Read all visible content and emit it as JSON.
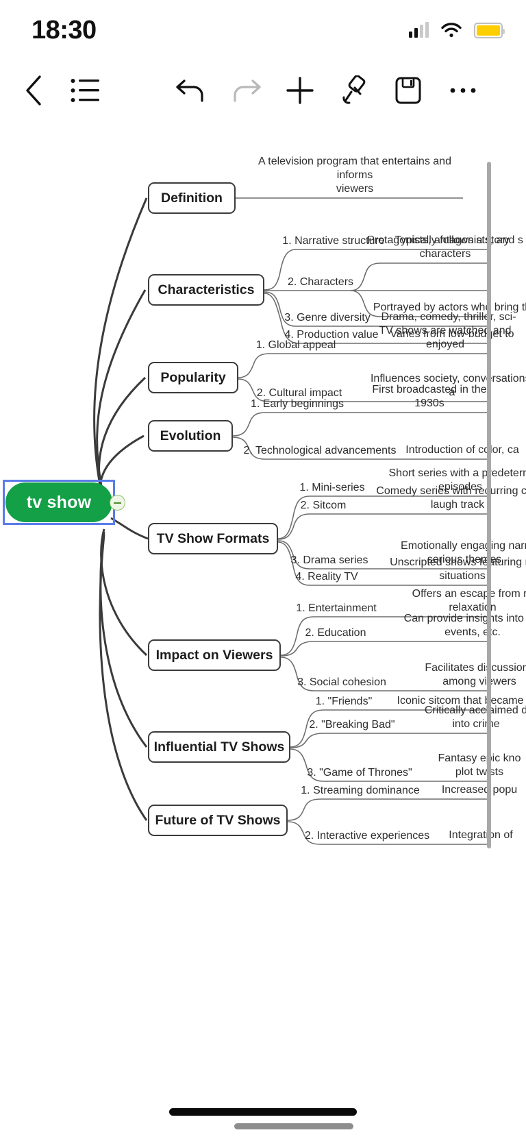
{
  "statusbar": {
    "time": "18:30",
    "signal_icon": "signal-bars-icon",
    "wifi_icon": "wifi-icon",
    "battery_icon": "battery-icon",
    "battery_color": "#ffce00"
  },
  "toolbar": {
    "back": "back-chevron-icon",
    "outline": "outline-list-icon",
    "undo": "undo-icon",
    "redo": "redo-icon",
    "add": "plus-icon",
    "brush": "paint-brush-icon",
    "save": "save-floppy-icon",
    "more": "more-options-icon"
  },
  "mindmap": {
    "root": {
      "label": "tv show",
      "fill": "#13a047",
      "selection_color": "#5b7ce8",
      "collapse_label": "−"
    },
    "branches": [
      {
        "label": "Definition",
        "items": [
          {
            "title": "",
            "desc": "A television program that entertains and informs\nviewers"
          }
        ]
      },
      {
        "label": "Characteristics",
        "items": [
          {
            "title": "1. Narrative structure",
            "desc": "Typically follows a story"
          },
          {
            "title": "2. Characters",
            "desc": "Protagonists, antagonists, and s\ncharacters"
          },
          {
            "title": "",
            "desc": "Portrayed by actors who bring th"
          },
          {
            "title": "3. Genre diversity",
            "desc": "Drama, comedy, thriller, sci-"
          },
          {
            "title": "4. Production value",
            "desc": "Varies from low-budget to"
          }
        ]
      },
      {
        "label": "Popularity",
        "items": [
          {
            "title": "1. Global appeal",
            "desc": "TV shows are watched and enjoyed"
          },
          {
            "title": "2. Cultural impact",
            "desc": "Influences society, conversations, a"
          }
        ]
      },
      {
        "label": "Evolution",
        "items": [
          {
            "title": "1. Early beginnings",
            "desc": "First broadcasted in the 1930s"
          },
          {
            "title": "2. Technological advancements",
            "desc": "Introduction of color, ca"
          }
        ]
      },
      {
        "label": "TV Show Formats",
        "items": [
          {
            "title": "1. Mini-series",
            "desc": "Short series with a predeterm\nepisodes"
          },
          {
            "title": "2. Sitcom",
            "desc": "Comedy series with recurring cha\nlaugh track"
          },
          {
            "title": "3. Drama series",
            "desc": "Emotionally engaging narr\nserious themes"
          },
          {
            "title": "4. Reality TV",
            "desc": "Unscripted shows featuring re\nsituations"
          }
        ]
      },
      {
        "label": "Impact on Viewers",
        "items": [
          {
            "title": "1. Entertainment",
            "desc": "Offers an escape from re\nrelaxation"
          },
          {
            "title": "2. Education",
            "desc": "Can provide insights into diff\nevents, etc."
          },
          {
            "title": "3. Social cohesion",
            "desc": "Facilitates discussions\namong viewers"
          }
        ]
      },
      {
        "label": "Influential TV Shows",
        "items": [
          {
            "title": "1. \"Friends\"",
            "desc": "Iconic sitcom that became"
          },
          {
            "title": "2. \"Breaking Bad\"",
            "desc": "Critically acclaimed d\ninto crime"
          },
          {
            "title": "3. \"Game of Thrones\"",
            "desc": "Fantasy epic kno\nplot twists"
          }
        ]
      },
      {
        "label": "Future of TV Shows",
        "items": [
          {
            "title": "1. Streaming dominance",
            "desc": "Increased popu"
          },
          {
            "title": "2. Interactive experiences",
            "desc": "Integration of"
          }
        ]
      }
    ]
  },
  "scrollbars": {
    "vertical": "vertical-scrollbar",
    "horizontal": "horizontal-scrollbar"
  },
  "home_indicator": "home-indicator"
}
